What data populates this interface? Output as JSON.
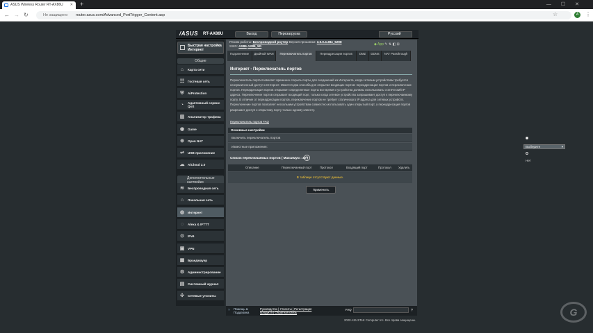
{
  "browser": {
    "tab_title": "ASUS Wireless Router RT-AX86U",
    "insecure_label": "Не защищено",
    "url": "router.asus.com/Advanced_PortTrigger_Content.asp",
    "profile_initial": "A"
  },
  "header": {
    "logo": "/ASUS",
    "model": "RT-AX86U",
    "logout": "Выход",
    "reboot": "Перезагрузка",
    "language": "Русский"
  },
  "status": {
    "mode_label": "Режим работы:",
    "mode_value": "Беспроводной роутер",
    "fw_label": "Версия прошивки:",
    "fw_value": "3.0.0.4.384_5298",
    "ssid_label": "SSID:",
    "ssid1": "AX86",
    "ssid2": "AX86_5G",
    "app_label": "App"
  },
  "sidebar": {
    "qis": "Быстрая настройка Интернет",
    "general": "Общие",
    "general_items": [
      "Карта сети",
      "Гостевая сеть",
      "AiProtection",
      "Адаптивный сервис QoS",
      "Анализатор трафика",
      "Game",
      "Open NAT",
      "USB-приложение",
      "AiCloud 2.0"
    ],
    "advanced": "Дополнительные настройки",
    "advanced_items": [
      "Беспроводная сеть",
      "Локальная сеть",
      "Интернет",
      "Alexa & IFTTT",
      "IPv6",
      "VPN",
      "Брандмауэр",
      "Администрирование",
      "Системный журнал",
      "Сетевые утилиты"
    ]
  },
  "tabs": [
    "Подключение",
    "Двойной WAN",
    "Переключатель портов",
    "Переадресация портов",
    "DMZ",
    "DDNS",
    "NAT Passthrough"
  ],
  "main": {
    "title": "Интернет - Переключатель портов",
    "description": "Переключатель порта позволяет временно открыть порты для соединений из Интернета, когда сетевым устройствам требуется неограниченный доступ к Интернет. Имеется два способа для открытия входящих портов: переадресация портов и переключение портов. Переадресация портов открывает определенные порты все время и устройства должны использовать статический IP адреса. Переключение портов открывает входящий порт, только когда сетевое устройство запрашивает доступ к переключаемому порту. В отличие от переадресации портов, переключение портов не требует статического IP адреса для сетевых устройств. Переключение портов позволяет нескольким устройствам совместно использовать один открытый порт, а переадресация портов разрешает доступ к открытому порту только одному клиенту.",
    "faq_link": "Переключатель портов FAQ",
    "basic_config": "Основные настройки",
    "enable_label": "Включить переключатель портов",
    "yes": "Да",
    "no": "Нет",
    "known_apps_label": "Известные приложения:",
    "known_apps_value": "Выберите",
    "list_label": "Список переключаемых портов ( Максимум : 32 )",
    "columns": [
      "Описание",
      "Переключаемый порт",
      "Протокол",
      "Входящий порт",
      "Протокол",
      "Удалить"
    ],
    "empty_text": "В таблице отсутствуют данные.",
    "apply": "Применить"
  },
  "footer": {
    "help": "Помощь & Поддержка",
    "links": "Руководство | Утилиты | Регистрация продукта | Обратная связь",
    "faq": "FAQ",
    "copyright": "2020 ASUSTeK Computer Inc. Все права защищены."
  }
}
